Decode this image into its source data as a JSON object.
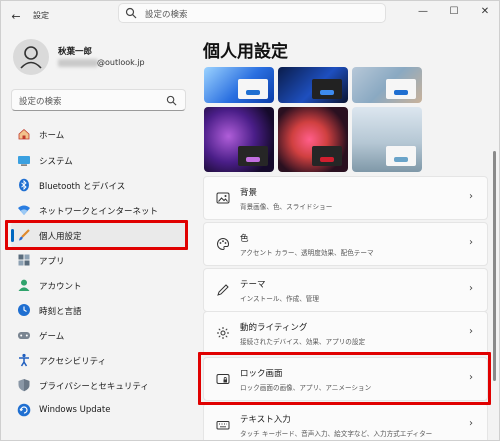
{
  "window": {
    "title": "設定",
    "back_glyph": "←",
    "minimize": "—",
    "maximize": "☐",
    "close": "✕"
  },
  "search": {
    "placeholder": "設定の検索"
  },
  "profile": {
    "name": "秋葉一郎",
    "email_visible": "@outlook.jp"
  },
  "sidebar": {
    "search_placeholder": "設定の検索",
    "items": [
      {
        "label": "ホーム",
        "icon": "home-icon"
      },
      {
        "label": "システム",
        "icon": "system-icon"
      },
      {
        "label": "Bluetooth とデバイス",
        "icon": "bluetooth-icon"
      },
      {
        "label": "ネットワークとインターネット",
        "icon": "wifi-icon"
      },
      {
        "label": "個人用設定",
        "icon": "brush-icon",
        "active": true
      },
      {
        "label": "アプリ",
        "icon": "apps-icon"
      },
      {
        "label": "アカウント",
        "icon": "account-icon"
      },
      {
        "label": "時刻と言語",
        "icon": "time-language-icon"
      },
      {
        "label": "ゲーム",
        "icon": "gamepad-icon"
      },
      {
        "label": "アクセシビリティ",
        "icon": "accessibility-icon"
      },
      {
        "label": "プライバシーとセキュリティ",
        "icon": "shield-icon"
      },
      {
        "label": "Windows Update",
        "icon": "update-icon"
      }
    ]
  },
  "main": {
    "title": "個人用設定",
    "cards": [
      {
        "title": "背景",
        "subtitle": "背景画像、色、スライドショー",
        "icon": "image-icon"
      },
      {
        "title": "色",
        "subtitle": "アクセント カラー、透明度効果、配色テーマ",
        "icon": "palette-icon"
      },
      {
        "title": "テーマ",
        "subtitle": "インストール、作成、管理",
        "icon": "pen-icon"
      },
      {
        "title": "動的ライティング",
        "subtitle": "接続されたデバイス、効果、アプリの設定",
        "icon": "lighting-icon"
      },
      {
        "title": "ロック画面",
        "subtitle": "ロック画面の画像、アプリ、アニメーション",
        "icon": "lock-screen-icon"
      },
      {
        "title": "テキスト入力",
        "subtitle": "タッチ キーボード、音声入力、絵文字など、入力方式エディター",
        "icon": "keyboard-icon"
      }
    ],
    "chevron": "›"
  },
  "colors": {
    "accent": "#0067c0",
    "highlight": "#e00000"
  }
}
